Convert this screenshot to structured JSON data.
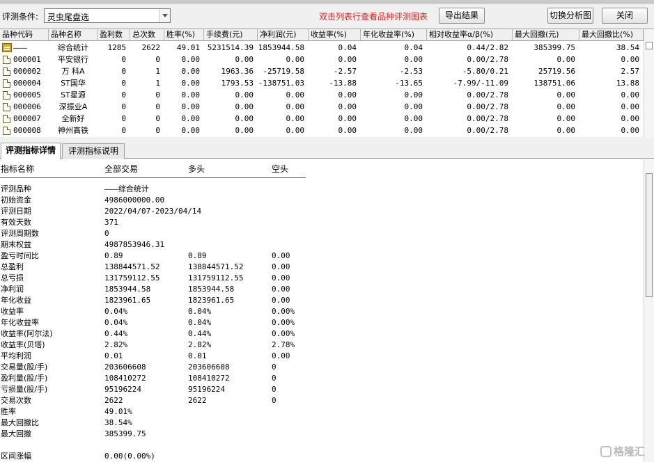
{
  "toolbar": {
    "condition_label": "评测条件:",
    "condition_value": "灵虫尾盘选",
    "hint": "双击列表行查看品种评测图表",
    "export_label": "导出结果",
    "switch_label": "切换分析图",
    "close_label": "关闭"
  },
  "grid": {
    "columns": [
      "品种代码",
      "品种名称",
      "盈利数",
      "总次数",
      "胜率(%)",
      "手续费(元)",
      "净利润(元)",
      "收益率(%)",
      "年化收益率(%)",
      "相对收益率α/β(%)",
      "最大回撤(元)",
      "最大回撤比(%)"
    ],
    "rows": [
      [
        "———",
        "综合统计",
        "1285",
        "2622",
        "49.01",
        "5231514.39",
        "1853944.58",
        "0.04",
        "0.04",
        "0.44/2.82",
        "385399.75",
        "38.54"
      ],
      [
        "000001",
        "平安银行",
        "0",
        "0",
        "0.00",
        "0.00",
        "0.00",
        "0.00",
        "0.00",
        "0.00/2.78",
        "0.00",
        "0.00"
      ],
      [
        "000002",
        "万 科A",
        "0",
        "1",
        "0.00",
        "1963.36",
        "-25719.58",
        "-2.57",
        "-2.53",
        "-5.80/0.21",
        "25719.56",
        "2.57"
      ],
      [
        "000004",
        "ST国华",
        "0",
        "1",
        "0.00",
        "1793.53",
        "-138751.03",
        "-13.88",
        "-13.65",
        "-7.99/-11.09",
        "138751.06",
        "13.88"
      ],
      [
        "000005",
        "ST星源",
        "0",
        "0",
        "0.00",
        "0.00",
        "0.00",
        "0.00",
        "0.00",
        "0.00/2.78",
        "0.00",
        "0.00"
      ],
      [
        "000006",
        "深振业A",
        "0",
        "0",
        "0.00",
        "0.00",
        "0.00",
        "0.00",
        "0.00",
        "0.00/2.78",
        "0.00",
        "0.00"
      ],
      [
        "000007",
        "全新好",
        "0",
        "0",
        "0.00",
        "0.00",
        "0.00",
        "0.00",
        "0.00",
        "0.00/2.78",
        "0.00",
        "0.00"
      ],
      [
        "000008",
        "神州高铁",
        "0",
        "0",
        "0.00",
        "0.00",
        "0.00",
        "0.00",
        "0.00",
        "0.00/2.78",
        "0.00",
        "0.00"
      ]
    ]
  },
  "tabs": {
    "detail": "评测指标详情",
    "explain": "评测指标说明"
  },
  "detail": {
    "headers": [
      "指标名称",
      "全部交易",
      "多头",
      "空头"
    ],
    "rows": [
      [
        "评测品种",
        "———综合统计",
        "",
        ""
      ],
      [
        "初始资金",
        "4986000000.00",
        "",
        ""
      ],
      [
        "评测日期",
        "2022/04/07-2023/04/14",
        "",
        ""
      ],
      [
        "有效天数",
        "371",
        "",
        ""
      ],
      [
        "评测周期数",
        "0",
        "",
        ""
      ],
      [
        "期末权益",
        "4987853946.31",
        "",
        ""
      ],
      [
        "盈亏时间比",
        "0.89",
        "0.89",
        "0.00"
      ],
      [
        "总盈利",
        "138844571.52",
        "138844571.52",
        "0.00"
      ],
      [
        "总亏损",
        "131759112.55",
        "131759112.55",
        "0.00"
      ],
      [
        "净利润",
        "1853944.58",
        "1853944.58",
        "0.00"
      ],
      [
        "年化收益",
        "1823961.65",
        "1823961.65",
        "0.00"
      ],
      [
        "收益率",
        "0.04%",
        "0.04%",
        "0.00%"
      ],
      [
        "年化收益率",
        "0.04%",
        "0.04%",
        "0.00%"
      ],
      [
        "收益率(阿尔法)",
        "0.44%",
        "0.44%",
        "0.00%"
      ],
      [
        "收益率(贝塔)",
        "2.82%",
        "2.82%",
        "2.78%"
      ],
      [
        "平均利润",
        "0.01",
        "0.01",
        "0.00"
      ],
      [
        "交易量(股/手)",
        "203606608",
        "203606608",
        "0"
      ],
      [
        "盈利量(股/手)",
        "108410272",
        "108410272",
        "0"
      ],
      [
        "亏损量(股/手)",
        "95196224",
        "95196224",
        "0"
      ],
      [
        "交易次数",
        "2622",
        "2622",
        "0"
      ],
      [
        "胜率",
        "49.01%",
        "",
        ""
      ],
      [
        "最大回撤比",
        "38.54%",
        "",
        ""
      ],
      [
        "最大回撤",
        "385399.75",
        "",
        ""
      ],
      [
        "",
        "",
        "",
        ""
      ],
      [
        "区间涨幅",
        "0.00(0.00%)",
        "",
        ""
      ]
    ]
  },
  "watermark": "格隆汇"
}
